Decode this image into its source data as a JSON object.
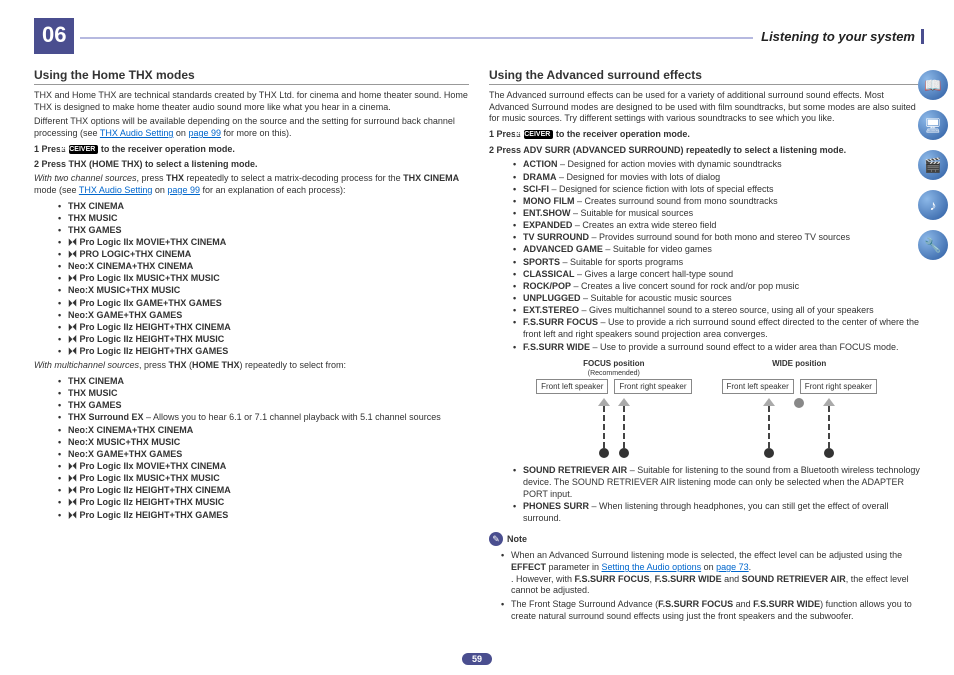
{
  "chapter": "06",
  "header_title": "Listening to your system",
  "page_number": "59",
  "left": {
    "h2": "Using the Home THX modes",
    "intro1": "THX and Home THX are technical standards created by THX Ltd. for cinema and home theater sound. Home THX is designed to make home theater audio sound more like what you hear in a cinema.",
    "intro2_pre": "Different THX options will be available depending on the source and the setting for surround back channel processing (see ",
    "intro2_link": "THX Audio Setting",
    "intro2_on": " on ",
    "intro2_page": "page 99",
    "intro2_post": " for more on this).",
    "step1_pre": "1    Press ",
    "step1_badge": "RECEIVER",
    "step1_post": " to the receiver operation mode.",
    "step2": "2    Press THX (HOME THX) to select a listening mode.",
    "twoch_pre": "With two channel sources",
    "twoch_mid": ", press ",
    "twoch_b1": "THX",
    "twoch_post1": " repeatedly to select a matrix-decoding process for the ",
    "twoch_b2": "THX CINEMA",
    "twoch_post2": " mode (see ",
    "twoch_link": "THX Audio Setting",
    "twoch_on": " on ",
    "twoch_page": "page 99",
    "twoch_end": " for an explanation of each process):",
    "list1": [
      "THX CINEMA",
      "THX MUSIC",
      "THX GAMES",
      "⏵⏴ Pro Logic IIx MOVIE+THX CINEMA",
      "⏵⏴ PRO LOGIC+THX CINEMA",
      "Neo:X CINEMA+THX CINEMA",
      "⏵⏴ Pro Logic IIx MUSIC+THX MUSIC",
      "Neo:X MUSIC+THX MUSIC",
      "⏵⏴ Pro Logic IIx GAME+THX GAMES",
      "Neo:X GAME+THX GAMES",
      "⏵⏴ Pro Logic IIz HEIGHT+THX CINEMA",
      "⏵⏴ Pro Logic IIz HEIGHT+THX MUSIC",
      "⏵⏴ Pro Logic IIz HEIGHT+THX GAMES"
    ],
    "multi_pre": "With multichannel sources",
    "multi_mid": ", press ",
    "multi_b1": "THX",
    "multi_paren": " (",
    "multi_b2": "HOME THX",
    "multi_post": ") repeatedly to select from:",
    "list2_a": [
      "THX CINEMA",
      "THX MUSIC",
      "THX GAMES"
    ],
    "list2_ex_b": "THX Surround EX",
    "list2_ex_t": " – Allows you to hear 6.1 or 7.1 channel playback with 5.1 channel sources",
    "list2_b": [
      "Neo:X CINEMA+THX CINEMA",
      "Neo:X MUSIC+THX MUSIC",
      "Neo:X GAME+THX GAMES",
      "⏵⏴ Pro Logic IIx MOVIE+THX CINEMA",
      "⏵⏴ Pro Logic IIx MUSIC+THX MUSIC",
      "⏵⏴ Pro Logic IIz HEIGHT+THX CINEMA",
      "⏵⏴ Pro Logic IIz HEIGHT+THX MUSIC",
      "⏵⏴ Pro Logic IIz HEIGHT+THX GAMES"
    ]
  },
  "right": {
    "h2": "Using the Advanced surround effects",
    "intro": "The Advanced surround effects can be used for a variety of additional surround sound effects. Most Advanced Surround modes are designed to be used with film soundtracks, but some modes are also suited for music sources. Try different settings with various soundtracks to see which you like.",
    "step1_pre": "1    Press ",
    "step1_badge": "RECEIVER",
    "step1_post": " to the receiver operation mode.",
    "step2": "2    Press ADV SURR (ADVANCED SURROUND) repeatedly to select a listening mode.",
    "modes": [
      {
        "b": "ACTION",
        "t": " – Designed for action movies with dynamic soundtracks"
      },
      {
        "b": "DRAMA",
        "t": " – Designed for movies with lots of dialog"
      },
      {
        "b": "SCI-FI",
        "t": " – Designed for science fiction with lots of special effects"
      },
      {
        "b": "MONO FILM",
        "t": " – Creates surround sound from mono soundtracks"
      },
      {
        "b": "ENT.SHOW",
        "t": " – Suitable for musical sources"
      },
      {
        "b": "EXPANDED",
        "t": " – Creates an extra wide stereo field"
      },
      {
        "b": "TV SURROUND",
        "t": " – Provides surround sound for both mono and stereo TV sources"
      },
      {
        "b": "ADVANCED GAME",
        "t": " – Suitable for video games"
      },
      {
        "b": "SPORTS",
        "t": " – Suitable for sports programs"
      },
      {
        "b": "CLASSICAL",
        "t": " – Gives a large concert hall-type sound"
      },
      {
        "b": "ROCK/POP",
        "t": " – Creates a live concert sound for rock and/or pop music"
      },
      {
        "b": "UNPLUGGED",
        "t": " – Suitable for acoustic music sources"
      },
      {
        "b": "EXT.STEREO",
        "t": " – Gives multichannel sound to a stereo source, using all of your speakers"
      },
      {
        "b": "F.S.SURR FOCUS",
        "t": " – Use to provide a rich surround sound effect directed to the center of where the front left and right speakers sound projection area converges."
      },
      {
        "b": "F.S.SURR WIDE",
        "t": " – Use to provide a surround sound effect to a wider area than FOCUS mode."
      }
    ],
    "dia": {
      "focus_title": "FOCUS position",
      "focus_sub": "(Recommended)",
      "wide_title": "WIDE position",
      "fl": "Front left speaker",
      "fr": "Front right speaker"
    },
    "modes2": [
      {
        "b": "SOUND RETRIEVER AIR",
        "t": " – Suitable for listening to the sound from a Bluetooth wireless technology device. The SOUND RETRIEVER AIR listening mode can only be selected when the ADAPTER PORT input."
      },
      {
        "b": "PHONES SURR",
        "t": " – When listening through headphones, you can still get the effect of overall surround."
      }
    ],
    "note_label": "Note",
    "notes": {
      "n1_a": "When an Advanced Surround listening mode is selected, the effect level can be adjusted using the ",
      "n1_b": "EFFECT",
      "n1_c": " parameter in ",
      "n1_link": "Setting the Audio options",
      "n1_on": " on ",
      "n1_page": "page 73",
      "n1_d": ". However, with ",
      "n1_e": "F.S.SURR FOCUS",
      "n1_f": ", ",
      "n1_g": "F.S.SURR WIDE",
      "n1_h": " and ",
      "n1_i": "SOUND RETRIEVER AIR",
      "n1_j": ", the effect level cannot be adjusted.",
      "n2_a": "The Front Stage Surround Advance (",
      "n2_b": "F.S.SURR FOCUS",
      "n2_c": " and ",
      "n2_d": "F.S.SURR WIDE",
      "n2_e": ") function allows you to create natural surround sound effects using just the front speakers and the subwoofer."
    }
  },
  "side_icons": [
    "📖",
    "🖥",
    "🎬",
    "♪",
    "🔧"
  ]
}
